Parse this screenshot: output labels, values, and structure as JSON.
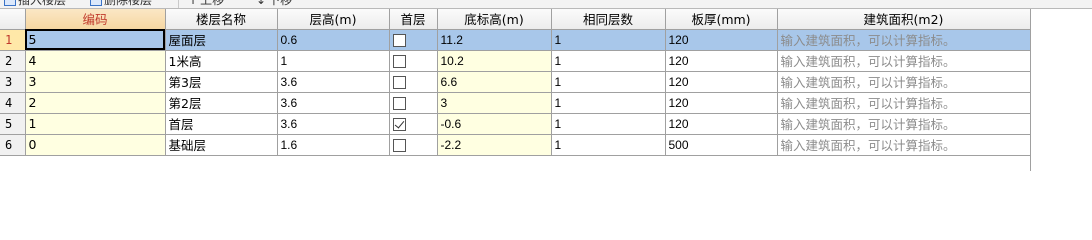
{
  "toolbar": {
    "insert_label": "插入楼层",
    "delete_label": "删除楼层",
    "up_label": "上移",
    "down_label": "下移"
  },
  "columns": [
    "编码",
    "楼层名称",
    "层高(m)",
    "首层",
    "底标高(m)",
    "相同层数",
    "板厚(mm)",
    "建筑面积(m2)"
  ],
  "rows": [
    {
      "rownum": "1",
      "code": "5",
      "name": "屋面层",
      "height": "0.6",
      "first": false,
      "bottom": "11.2",
      "same": "1",
      "thickness": "120",
      "area": "输入建筑面积，可以计算指标。"
    },
    {
      "rownum": "2",
      "code": "4",
      "name": "1米高",
      "height": "1",
      "first": false,
      "bottom": "10.2",
      "same": "1",
      "thickness": "120",
      "area": "输入建筑面积，可以计算指标。"
    },
    {
      "rownum": "3",
      "code": "3",
      "name": "第3层",
      "height": "3.6",
      "first": false,
      "bottom": "6.6",
      "same": "1",
      "thickness": "120",
      "area": "输入建筑面积，可以计算指标。"
    },
    {
      "rownum": "4",
      "code": "2",
      "name": "第2层",
      "height": "3.6",
      "first": false,
      "bottom": "3",
      "same": "1",
      "thickness": "120",
      "area": "输入建筑面积，可以计算指标。"
    },
    {
      "rownum": "5",
      "code": "1",
      "name": "首层",
      "height": "3.6",
      "first": true,
      "bottom": "-0.6",
      "same": "1",
      "thickness": "120",
      "area": "输入建筑面积，可以计算指标。"
    },
    {
      "rownum": "6",
      "code": "0",
      "name": "基础层",
      "height": "1.6",
      "first": false,
      "bottom": "-2.2",
      "same": "1",
      "thickness": "500",
      "area": "输入建筑面积，可以计算指标。"
    }
  ],
  "selected_row": "1"
}
